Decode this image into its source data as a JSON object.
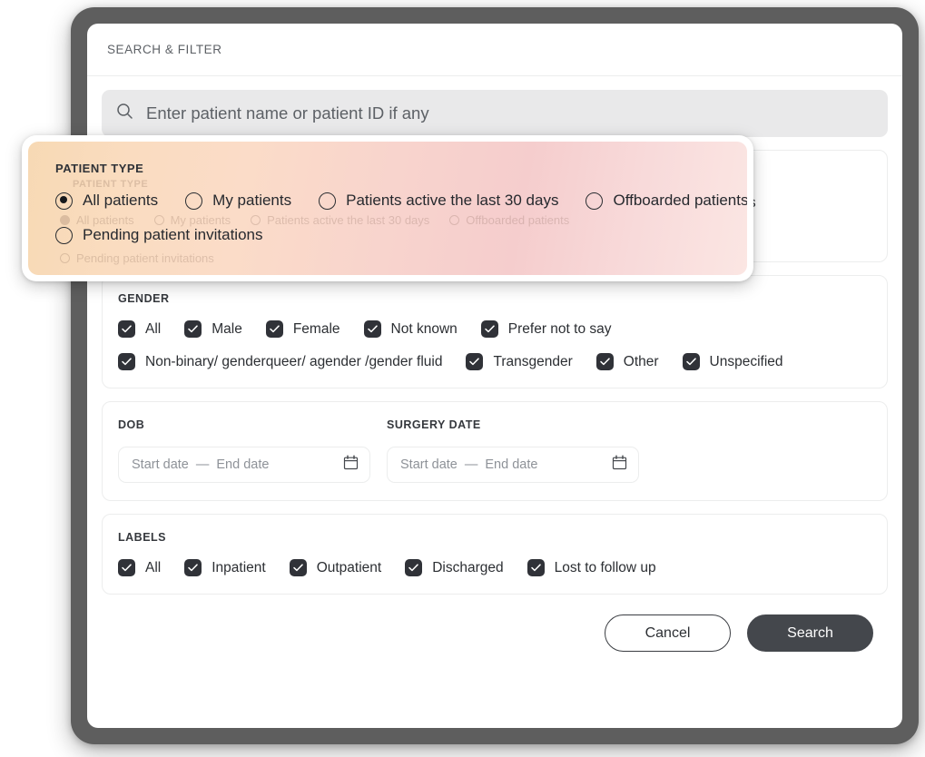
{
  "dialog": {
    "title": "SEARCH & FILTER"
  },
  "search": {
    "placeholder": "Enter patient name or patient ID if any",
    "value": "",
    "icon": "search-icon"
  },
  "patient_type": {
    "title": "PATIENT TYPE",
    "selected": "All patients",
    "options": [
      {
        "label": "All patients",
        "checked": true
      },
      {
        "label": "My patients",
        "checked": false
      },
      {
        "label": "Patients active the last 30 days",
        "checked": false
      },
      {
        "label": "Offboarded patients",
        "checked": false
      },
      {
        "label": "Pending patient invitations",
        "checked": false
      }
    ]
  },
  "gender": {
    "title": "GENDER",
    "row1": [
      {
        "label": "All",
        "checked": true
      },
      {
        "label": "Male",
        "checked": true
      },
      {
        "label": "Female",
        "checked": true
      },
      {
        "label": "Not known",
        "checked": true
      },
      {
        "label": "Prefer not to say",
        "checked": true
      }
    ],
    "row2": [
      {
        "label": "Non-binary/ genderqueer/ agender /gender fluid",
        "checked": true
      },
      {
        "label": "Transgender",
        "checked": true
      },
      {
        "label": "Other",
        "checked": true
      },
      {
        "label": "Unspecified",
        "checked": true
      }
    ]
  },
  "dob": {
    "title": "DOB",
    "start_placeholder": "Start date",
    "separator": "—",
    "end_placeholder": "End date",
    "start_value": "",
    "end_value": "",
    "icon": "calendar-icon"
  },
  "surgery_date": {
    "title": "SURGERY DATE",
    "start_placeholder": "Start date",
    "separator": "—",
    "end_placeholder": "End date",
    "start_value": "",
    "end_value": "",
    "icon": "calendar-icon"
  },
  "labels": {
    "title": "LABELS",
    "items": [
      {
        "label": "All",
        "checked": true
      },
      {
        "label": "Inpatient",
        "checked": true
      },
      {
        "label": "Outpatient",
        "checked": true
      },
      {
        "label": "Discharged",
        "checked": true
      },
      {
        "label": "Lost to follow up",
        "checked": true
      }
    ]
  },
  "footer": {
    "cancel_label": "Cancel",
    "search_label": "Search"
  },
  "colors": {
    "bezel": "#5e5e5e",
    "checkbox": "#303238",
    "search_button": "#44474c",
    "search_field_bg": "#e9e9ea",
    "card_border": "#eceded",
    "overlay_gradient_start": "#f7d9b4",
    "overlay_gradient_end": "#fbe6e3"
  }
}
